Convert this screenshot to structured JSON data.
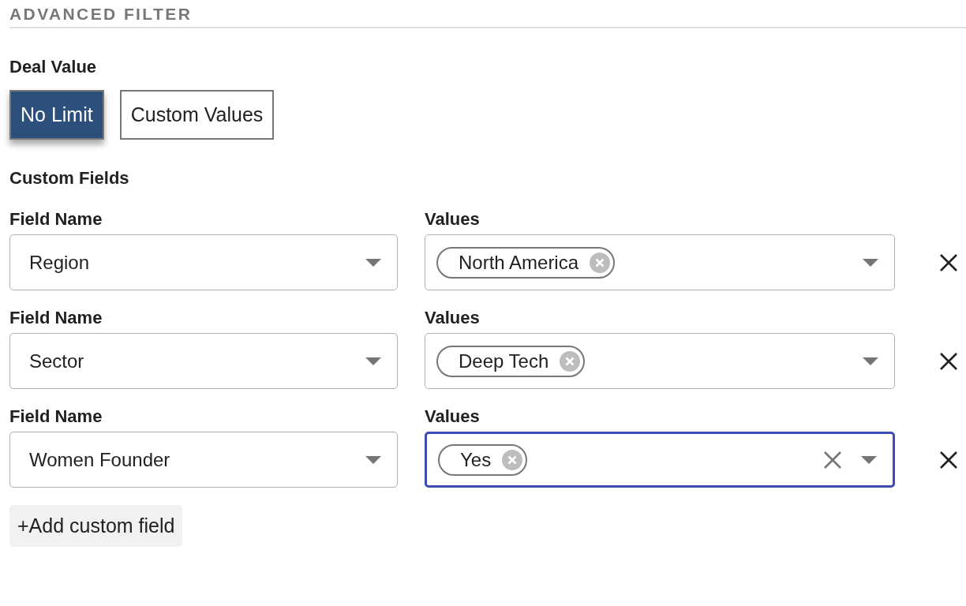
{
  "section_title": "ADVANCED FILTER",
  "deal_value": {
    "label": "Deal Value",
    "options": [
      {
        "label": "No Limit",
        "selected": true
      },
      {
        "label": "Custom Values",
        "selected": false
      }
    ]
  },
  "custom_fields": {
    "label": "Custom Fields",
    "rows": [
      {
        "field_name_label": "Field Name",
        "field_name": "Region",
        "values_label": "Values",
        "values": [
          "North America"
        ],
        "focused": false
      },
      {
        "field_name_label": "Field Name",
        "field_name": "Sector",
        "values_label": "Values",
        "values": [
          "Deep Tech"
        ],
        "focused": false
      },
      {
        "field_name_label": "Field Name",
        "field_name": "Women Founder",
        "values_label": "Values",
        "values": [
          "Yes"
        ],
        "focused": true
      }
    ],
    "add_button": "+Add custom field"
  }
}
